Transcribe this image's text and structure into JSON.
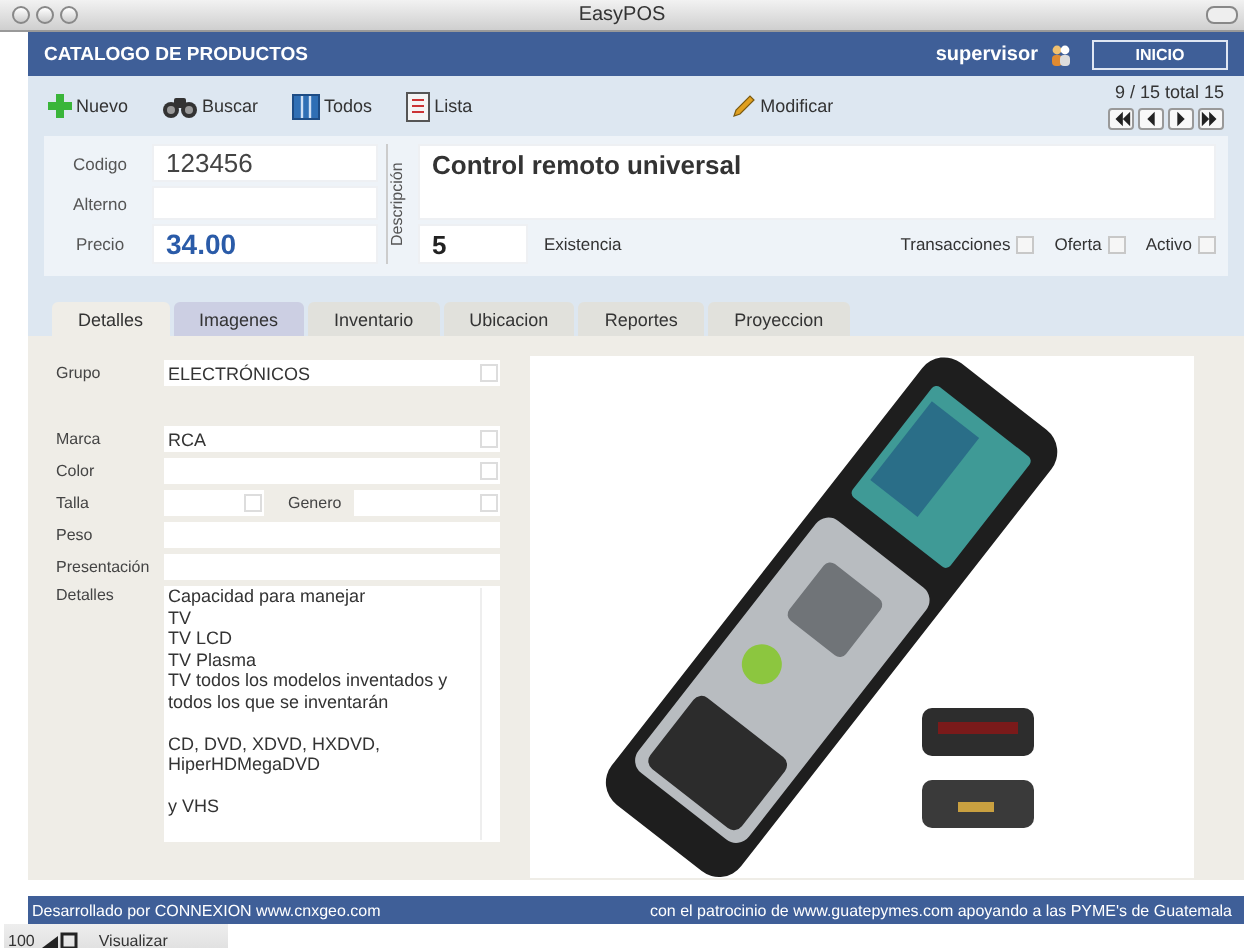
{
  "window": {
    "title": "EasyPOS"
  },
  "header": {
    "title": "CATALOGO DE PRODUCTOS",
    "user": "supervisor",
    "home_button": "INICIO"
  },
  "toolbar": [
    {
      "label": "Nuevo",
      "kind": "plus"
    },
    {
      "label": "Buscar",
      "kind": "binoculars"
    },
    {
      "label": "Todos",
      "kind": "columns"
    },
    {
      "label": "Lista",
      "kind": "list"
    },
    {
      "label": "Modificar",
      "kind": "pencil"
    }
  ],
  "pager": {
    "position": "9 / 15 total 15"
  },
  "product": {
    "code_label": "Codigo",
    "code": "123456",
    "alt_label": "Alterno",
    "price_label": "Precio",
    "price": "34.00",
    "description_label": "Descripción",
    "description": "Control remoto universal",
    "stock": "5",
    "stock_label": "Existencia"
  },
  "flags": [
    {
      "label": "Transacciones",
      "checked": false
    },
    {
      "label": "Oferta",
      "checked": false
    },
    {
      "label": "Activo",
      "checked": false
    }
  ],
  "tabs": [
    {
      "label": "Detalles",
      "selected": true,
      "highlighted": false
    },
    {
      "label": "Imagenes",
      "selected": false,
      "highlighted": true
    },
    {
      "label": "Inventario",
      "selected": false,
      "highlighted": false
    },
    {
      "label": "Ubicacion",
      "selected": false,
      "highlighted": false
    },
    {
      "label": "Reportes",
      "selected": false,
      "highlighted": false
    },
    {
      "label": "Proyeccion",
      "selected": false,
      "highlighted": false
    }
  ],
  "fields": [
    {
      "kind": "select",
      "label": "Grupo",
      "value": "ELECTRÓNICOS"
    },
    {
      "kind": "select",
      "label": "Marca",
      "value": "RCA"
    },
    {
      "kind": "select",
      "label": "Color"
    },
    {
      "kind": "pair",
      "label": "Talla",
      "second_label": "Genero"
    },
    {
      "kind": "text",
      "label": "Peso"
    },
    {
      "kind": "text",
      "label": "Presentación"
    },
    {
      "kind": "textarea",
      "label": "Detalles",
      "value": "Capacidad para manejar\nTV\nTV LCD\nTV Plasma\nTV todos los modelos inventados y todos los que se inventarán\n\nCD, DVD, XDVD, HXDVD, HiperHDMegaDVD\n\ny VHS"
    }
  ],
  "footer": {
    "left": "Desarrollado por CONNEXION www.cnxgeo.com",
    "right": "con el patrocinio de www.guatepymes.com apoyando a las PYME's de Guatemala"
  },
  "status_bar": {
    "zoom": "100",
    "mode": "Visualizar"
  }
}
